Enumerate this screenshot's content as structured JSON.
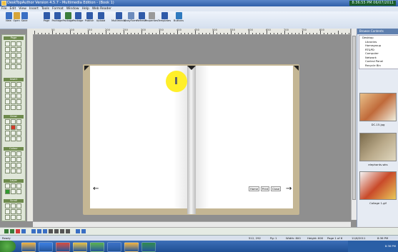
{
  "window": {
    "title": "DeskTopAuthor Version 4.5.7 - Multimedia Edition - (Book 1)"
  },
  "clock": "8:36:55 PM 06/07/2011",
  "menu": [
    "File",
    "Edit",
    "View",
    "Insert",
    "Tools",
    "Format",
    "Window",
    "Help",
    "Web Reader"
  ],
  "toolbar": [
    {
      "label": "New",
      "color": "#3a6fc4"
    },
    {
      "label": "Open",
      "color": "#d7a53a"
    },
    {
      "label": "Save",
      "color": "#3a6fc4"
    },
    {
      "label": "Page",
      "color": "#2f5aa8"
    },
    {
      "label": "Package",
      "color": "#2f5aa8"
    },
    {
      "label": "Package",
      "color": "#3b7d3b"
    },
    {
      "label": "Package",
      "color": "#2f5aa8"
    },
    {
      "label": "Publish",
      "color": "#2f5aa8"
    },
    {
      "label": "Upload",
      "color": "#2f5aa8"
    },
    {
      "label": "Multimedia",
      "color": "#2f5aa8"
    },
    {
      "label": "EasyForm",
      "color": "#6b8bbd"
    },
    {
      "label": "Refresh",
      "color": "#2f5aa8"
    },
    {
      "label": "Properties",
      "color": "#999999"
    },
    {
      "label": "Templates",
      "color": "#2f5aa8"
    },
    {
      "label": "Buttons",
      "color": "#2f7abf"
    }
  ],
  "ruler_numbers": [
    "50",
    "100",
    "150",
    "200",
    "250",
    "300",
    "350",
    "400",
    "450",
    "500",
    "550",
    "600",
    "650",
    "700",
    "750",
    "800"
  ],
  "toolbox": {
    "sections": [
      "Page",
      "Insert",
      "Draw",
      "Colour",
      "Layer",
      "Scroll"
    ]
  },
  "right_panel": {
    "header": "Browse Contents",
    "tree": [
      "Desktop",
      "Libraries",
      "Homegroup",
      "RT&PD",
      "Computer",
      "Network",
      "Control Panel",
      "Recycle Bin"
    ],
    "thumbs": [
      {
        "label": "DC-15.jpg",
        "colors": [
          "#e8c08a",
          "#c06a3a",
          "#f0f0e0"
        ]
      },
      {
        "label": "elephants.wks",
        "colors": [
          "#7a6a4a",
          "#b8a888",
          "#e0d8c0"
        ]
      },
      {
        "label": "Collage 1.gif",
        "colors": [
          "#f4f4f4",
          "#c94a2a",
          "#e8c85a"
        ]
      }
    ]
  },
  "book": {
    "left_arrow": "←",
    "right_arrow": "→",
    "nav": [
      "Home",
      "Print",
      "Close"
    ]
  },
  "statusbar": [
    "Ready",
    "512, 292",
    "Pg: 1",
    "Width: 800",
    "Height: 600",
    "Page 1 of 6",
    "11/6/2011",
    "8:36 PM"
  ],
  "tray": "8:36 PM"
}
